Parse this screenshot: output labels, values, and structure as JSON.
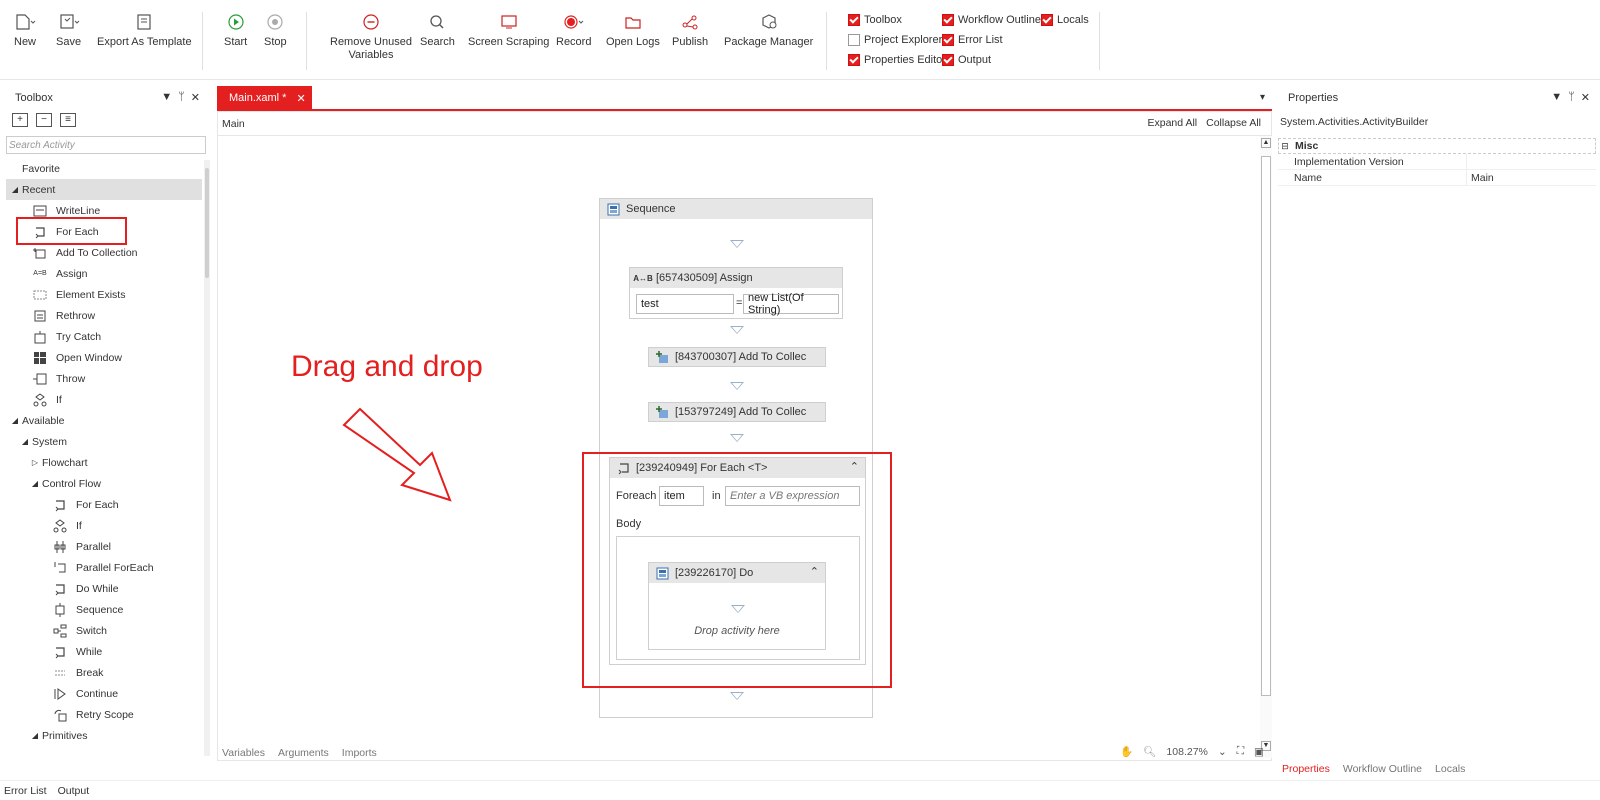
{
  "ribbon": {
    "buttons": {
      "new": "New",
      "save": "Save",
      "export": "Export As Template",
      "start": "Start",
      "stop": "Stop",
      "remove_unused_1": "Remove Unused",
      "remove_unused_2": "Variables",
      "search": "Search",
      "screen_scraping": "Screen Scraping",
      "record": "Record",
      "open_logs": "Open Logs",
      "publish": "Publish",
      "package_manager": "Package Manager"
    },
    "checkboxes": {
      "toolbox": "Toolbox",
      "workflow_outline": "Workflow Outline",
      "locals": "Locals",
      "project_explorer": "Project Explorer",
      "error_list": "Error List",
      "properties_editor": "Properties Editor",
      "output": "Output"
    }
  },
  "toolbox": {
    "title": "Toolbox",
    "search_placeholder": "Search Activity",
    "items": {
      "favorite": "Favorite",
      "recent": "Recent",
      "writeline": "WriteLine",
      "for_each": "For Each",
      "add_to_collection": "Add To Collection",
      "assign": "Assign",
      "element_exists": "Element Exists",
      "rethrow": "Rethrow",
      "try_catch": "Try Catch",
      "open_window": "Open Window",
      "throw": "Throw",
      "if": "If",
      "available": "Available",
      "system": "System",
      "flowchart": "Flowchart",
      "control_flow": "Control Flow",
      "cf_for_each": "For Each",
      "cf_if": "If",
      "parallel": "Parallel",
      "parallel_foreach": "Parallel ForEach",
      "do_while": "Do While",
      "sequence": "Sequence",
      "switch": "Switch",
      "while": "While",
      "break": "Break",
      "continue": "Continue",
      "retry_scope": "Retry Scope",
      "primitives": "Primitives"
    }
  },
  "designer": {
    "tab": "Main.xaml *",
    "breadcrumb": "Main",
    "expand_all": "Expand All",
    "collapse_all": "Collapse All",
    "sequence": "Sequence",
    "assign_title": "[657430509] Assign",
    "assign_left": "test",
    "assign_eq": "=",
    "assign_right": "new List(Of String)",
    "add1": "[843700307] Add To Collec",
    "add2": "[153797249] Add To Collec",
    "foreach_title": "[239240949] For Each <T>",
    "foreach_label": "Foreach",
    "foreach_item": "item",
    "foreach_in": "in",
    "foreach_expr": "Enter a VB expression",
    "body": "Body",
    "do_title": "[239226170] Do",
    "drop_here": "Drop activity here",
    "annotation": "Drag and drop",
    "bottom_tabs": {
      "variables": "Variables",
      "arguments": "Arguments",
      "imports": "Imports"
    },
    "zoom": "108.27%"
  },
  "properties": {
    "title": "Properties",
    "object": "System.Activities.ActivityBuilder",
    "category": "Misc",
    "rows": [
      {
        "name": "Implementation Version",
        "value": ""
      },
      {
        "name": "Name",
        "value": "Main"
      }
    ],
    "tabs": {
      "properties": "Properties",
      "workflow_outline": "Workflow Outline",
      "locals": "Locals"
    }
  },
  "status": {
    "error_list": "Error List",
    "output": "Output"
  },
  "colors": {
    "accent": "#e41f1f",
    "header_gray": "#e6e6e6",
    "arrow_blue": "#9bb0c8"
  }
}
